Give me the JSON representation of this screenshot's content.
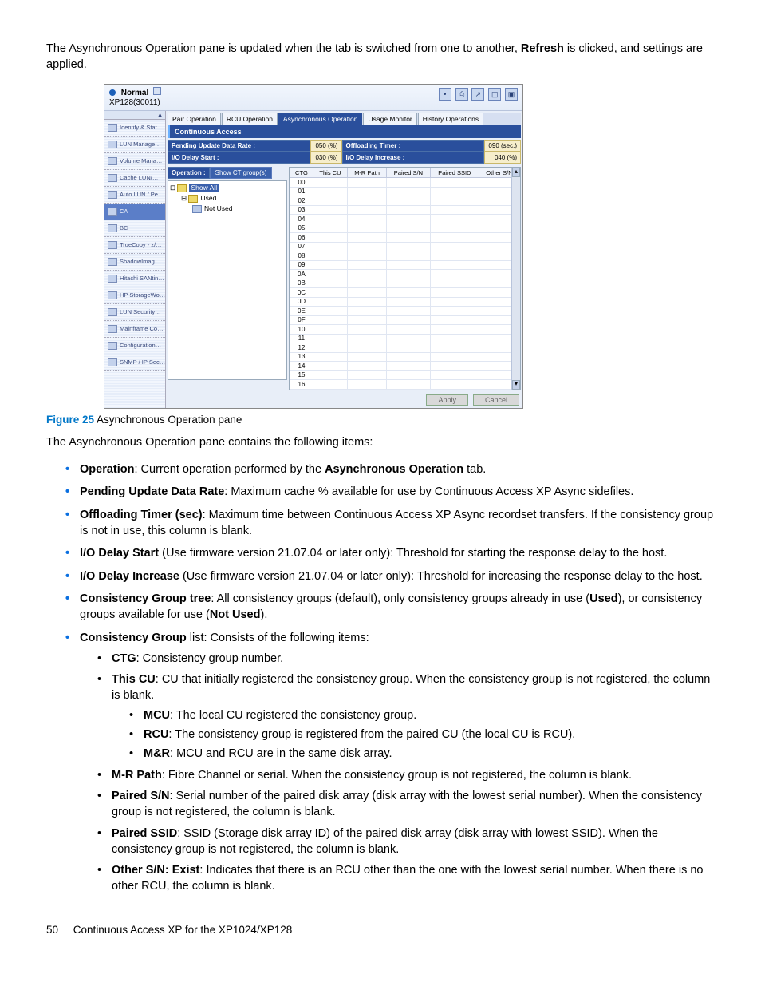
{
  "intro": {
    "pre": "The Asynchronous Operation pane is updated when the tab is switched from one to another, ",
    "bold": "Refresh",
    "post": " is clicked, and settings are applied."
  },
  "figure": {
    "title_line1": "Normal",
    "title_line2": "XP128(30011)",
    "toolbar_icons": [
      "•",
      "⎙",
      "↗",
      "◫",
      "▣"
    ],
    "sidebar": [
      "Identify & Stat",
      "LUN Manage…",
      "Volume Mana…",
      "Cache LUN/…",
      "Auto LUN / Pe…",
      "CA",
      "BC",
      "TrueCopy - z/…",
      "ShadowImag…",
      "Hitachi SANtin…",
      "HP StorageWo…",
      "LUN Security…",
      "Mainframe Co…",
      "Configuration…",
      "SNMP / IP Sec…"
    ],
    "sidebar_active_index": 5,
    "tabs": [
      "Pair Operation",
      "RCU Operation",
      "Asynchronous Operation",
      "Usage Monitor",
      "History Operations"
    ],
    "tabs_active_index": 2,
    "pane_title": "Continuous Access",
    "stats": {
      "r1c1_label": "Pending Update Data Rate :",
      "r1c1_value": "050 (%)",
      "r1c2_label": "Offloading Timer :",
      "r1c2_value": "090 (sec.)",
      "r2c1_label": "I/O Delay Start :",
      "r2c1_value": "030 (%)",
      "r2c2_label": "I/O Delay Increase :",
      "r2c2_value": "040 (%)"
    },
    "operation_label": "Operation :",
    "operation_button": "Show CT group(s)",
    "tree": {
      "root": "Show All",
      "used": "Used",
      "not_used": "Not Used"
    },
    "grid_headers": [
      "CTG",
      "This CU",
      "M-R Path",
      "Paired S/N",
      "Paired SSID",
      "Other S/N"
    ],
    "grid_rows": [
      "00",
      "01",
      "02",
      "03",
      "04",
      "05",
      "06",
      "07",
      "08",
      "09",
      "0A",
      "0B",
      "0C",
      "0D",
      "0E",
      "0F",
      "10",
      "11",
      "12",
      "13",
      "14",
      "15",
      "16"
    ],
    "buttons": {
      "apply": "Apply",
      "cancel": "Cancel"
    }
  },
  "caption": {
    "label": "Figure 25",
    "text": "  Asynchronous Operation pane"
  },
  "lead2": "The Asynchronous Operation pane contains the following items:",
  "b1": {
    "label": "Operation",
    "text": ": Current operation performed by the ",
    "bold2": "Asynchronous Operation",
    "post": " tab."
  },
  "b2": {
    "label": "Pending Update Data Rate",
    "text": ": Maximum cache % available for use by Continuous Access XP Async sidefiles."
  },
  "b3": {
    "label": "Offloading Timer (sec)",
    "text": ": Maximum time between Continuous Access XP Async recordset transfers. If the consistency group is not in use, this column is blank."
  },
  "b4": {
    "label": "I/O Delay Start",
    "text": " (Use firmware version 21.07.04 or later only): Threshold for starting the response delay to the host."
  },
  "b5": {
    "label": "I/O Delay Increase",
    "text": " (Use firmware version 21.07.04 or later only): Threshold for increasing the response delay to the host."
  },
  "b6": {
    "label": "Consistency Group tree",
    "text": ": All consistency groups (default), only consistency groups already in use (",
    "bold2": "Used",
    "mid": "), or consistency groups available for use (",
    "bold3": "Not Used",
    "post": ")."
  },
  "b7": {
    "label": "Consistency Group",
    "text": " list: Consists of the following items:"
  },
  "s1": {
    "label": "CTG",
    "text": ": Consistency group number."
  },
  "s2": {
    "label": "This CU",
    "text": ": CU that initially registered the consistency group. When the consistency group is not registered, the column is blank."
  },
  "ss1": {
    "label": "MCU",
    "text": ": The local CU registered the consistency group."
  },
  "ss2": {
    "label": "RCU",
    "text": ": The consistency group is registered from the paired CU (the local CU is RCU)."
  },
  "ss3": {
    "label": "M&R",
    "text": ": MCU and RCU are in the same disk array."
  },
  "s3": {
    "label": "M-R Path",
    "text": ": Fibre Channel or serial. When the consistency group is not registered, the column is blank."
  },
  "s4": {
    "label": "Paired S/N",
    "text": ": Serial number of the paired disk array (disk array with the lowest serial number). When the consistency group is not registered, the column is blank."
  },
  "s5": {
    "label": "Paired SSID",
    "text": ": SSID (Storage disk array ID) of the paired disk array (disk array with lowest SSID). When the consistency group is not registered, the column is blank."
  },
  "s6": {
    "label": "Other S/N: Exist",
    "text": ": Indicates that there is an RCU other than the one with the lowest serial number. When there is no other RCU, the column is blank."
  },
  "footer": {
    "page": "50",
    "title": "Continuous Access XP for the XP1024/XP128"
  }
}
